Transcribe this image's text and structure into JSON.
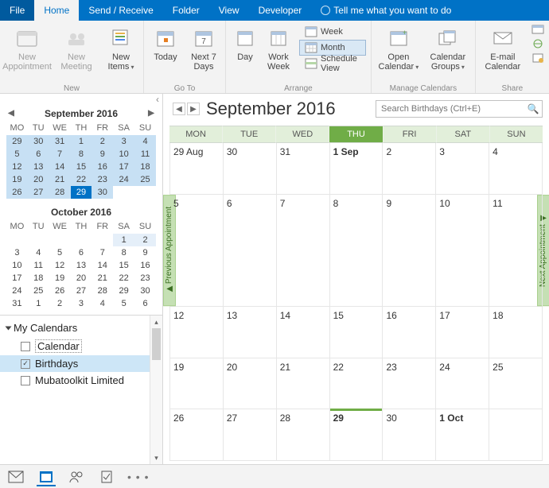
{
  "tabs": {
    "file": "File",
    "home": "Home",
    "send": "Send / Receive",
    "folder": "Folder",
    "view": "View",
    "developer": "Developer",
    "tell": "Tell me what you want to do"
  },
  "ribbon": {
    "new_appointment": "New\nAppointment",
    "new_meeting": "New\nMeeting",
    "new_items": "New\nItems",
    "today": "Today",
    "next7": "Next 7\nDays",
    "day": "Day",
    "work_week": "Work\nWeek",
    "week": "Week",
    "month": "Month",
    "schedule": "Schedule View",
    "open_calendar": "Open\nCalendar",
    "calendar_groups": "Calendar\nGroups",
    "email_calendar": "E-mail\nCalendar",
    "grp_new": "New",
    "grp_goto": "Go To",
    "grp_arrange": "Arrange",
    "grp_manage": "Manage Calendars",
    "grp_share": "Share"
  },
  "miniSep": {
    "title": "September 2016",
    "dow": [
      "MO",
      "TU",
      "WE",
      "TH",
      "FR",
      "SA",
      "SU"
    ],
    "rows": [
      [
        "29",
        "30",
        "31",
        "1",
        "2",
        "3",
        "4"
      ],
      [
        "5",
        "6",
        "7",
        "8",
        "9",
        "10",
        "11"
      ],
      [
        "12",
        "13",
        "14",
        "15",
        "16",
        "17",
        "18"
      ],
      [
        "19",
        "20",
        "21",
        "22",
        "23",
        "24",
        "25"
      ],
      [
        "26",
        "27",
        "28",
        "29",
        "30",
        "",
        ""
      ]
    ]
  },
  "miniOct": {
    "title": "October 2016",
    "dow": [
      "MO",
      "TU",
      "WE",
      "TH",
      "FR",
      "SA",
      "SU"
    ],
    "rows": [
      [
        "",
        "",
        "",
        "",
        "",
        "1",
        "2"
      ],
      [
        "3",
        "4",
        "5",
        "6",
        "7",
        "8",
        "9"
      ],
      [
        "10",
        "11",
        "12",
        "13",
        "14",
        "15",
        "16"
      ],
      [
        "17",
        "18",
        "19",
        "20",
        "21",
        "22",
        "23"
      ],
      [
        "24",
        "25",
        "26",
        "27",
        "28",
        "29",
        "30"
      ],
      [
        "31",
        "1",
        "2",
        "3",
        "4",
        "5",
        "6"
      ]
    ]
  },
  "calList": {
    "title": "My Calendars",
    "item0": "Calendar",
    "item1": "Birthdays",
    "item2": "Mubatoolkit Limited"
  },
  "calview": {
    "title": "September 2016",
    "search_ph": "Search Birthdays (Ctrl+E)",
    "dow": [
      "MON",
      "TUE",
      "WED",
      "THU",
      "FRI",
      "SAT",
      "SUN"
    ],
    "weeks": [
      [
        "29 Aug",
        "30",
        "31",
        "1 Sep",
        "2",
        "3",
        "4"
      ],
      [
        "5",
        "6",
        "7",
        "8",
        "9",
        "10",
        "11"
      ],
      [
        "12",
        "13",
        "14",
        "15",
        "16",
        "17",
        "18"
      ],
      [
        "19",
        "20",
        "21",
        "22",
        "23",
        "24",
        "25"
      ],
      [
        "26",
        "27",
        "28",
        "29",
        "30",
        "1 Oct",
        ""
      ]
    ],
    "prev_appt": "Previous Appointment",
    "next_appt": "Next Appointment"
  }
}
